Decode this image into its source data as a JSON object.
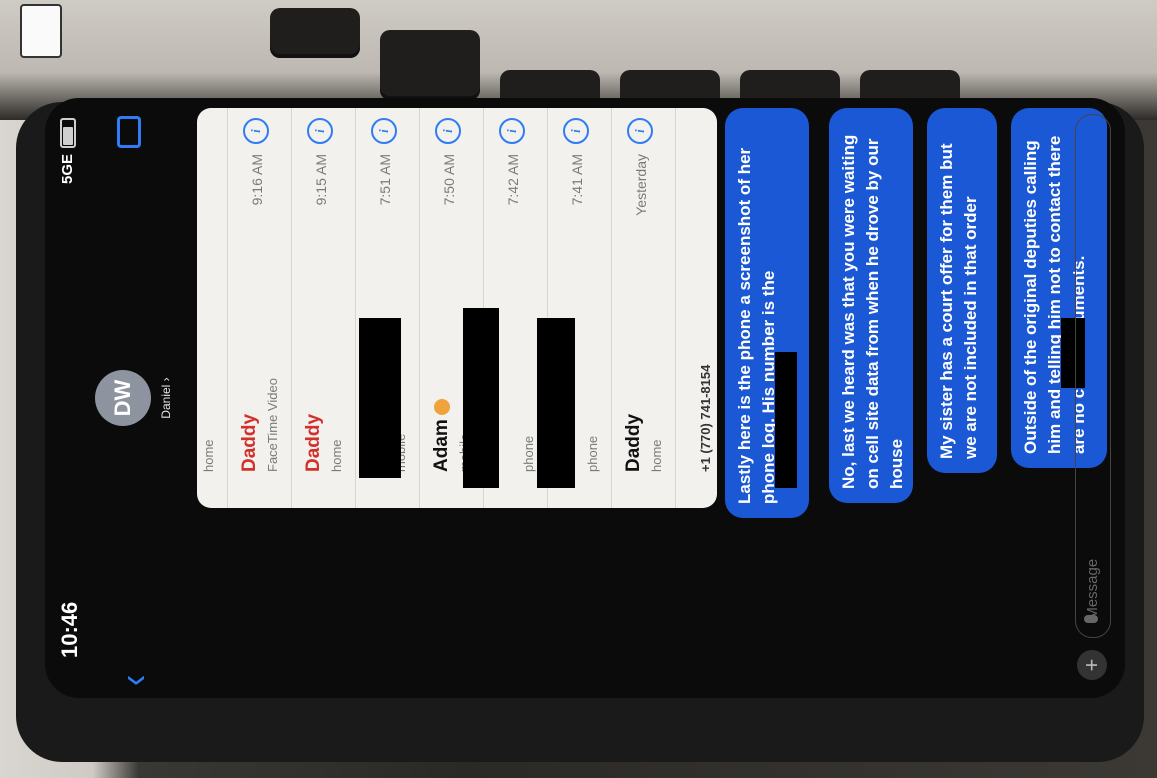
{
  "status": {
    "time": "10:46",
    "signal": "5GE"
  },
  "contact": {
    "initials": "DW",
    "name": "Daniel"
  },
  "call_log": {
    "first_row_sub": "home",
    "rows": [
      {
        "name": "Daddy",
        "sub": "FaceTime Video",
        "time": "9:16 AM",
        "missed": true
      },
      {
        "name": "Daddy",
        "sub": "home",
        "time": "9:15 AM",
        "missed": true
      },
      {
        "name": "",
        "sub": "mobile",
        "time": "7:51 AM",
        "missed": false
      },
      {
        "name": "Adam",
        "sub": "mobile",
        "time": "7:50 AM",
        "missed": false
      },
      {
        "name": "",
        "sub": "phone",
        "time": "7:42 AM",
        "missed": false
      },
      {
        "name": "",
        "sub": "phone",
        "time": "7:41 AM",
        "missed": false
      },
      {
        "name": "Daddy",
        "sub": "home",
        "time": "Yesterday",
        "missed": false
      }
    ],
    "footer_number": "+1 (770) 741-8154"
  },
  "messages": [
    {
      "text": "Lastly here is the phone a screenshot of her phone log. His number is the"
    },
    {
      "text": "No, last we heard was that you were waiting on cell site data from when he drove by our house"
    },
    {
      "text": "My sister has a court offer for them but we are not included in that order"
    },
    {
      "text": "Outside of the original deputies calling him and telling him not to contact          there are no court documents."
    }
  ],
  "input": {
    "placeholder": "iMessage"
  },
  "colors": {
    "bubble": "#1b58d6",
    "accent": "#2f7cf6",
    "missed": "#d2302a"
  }
}
